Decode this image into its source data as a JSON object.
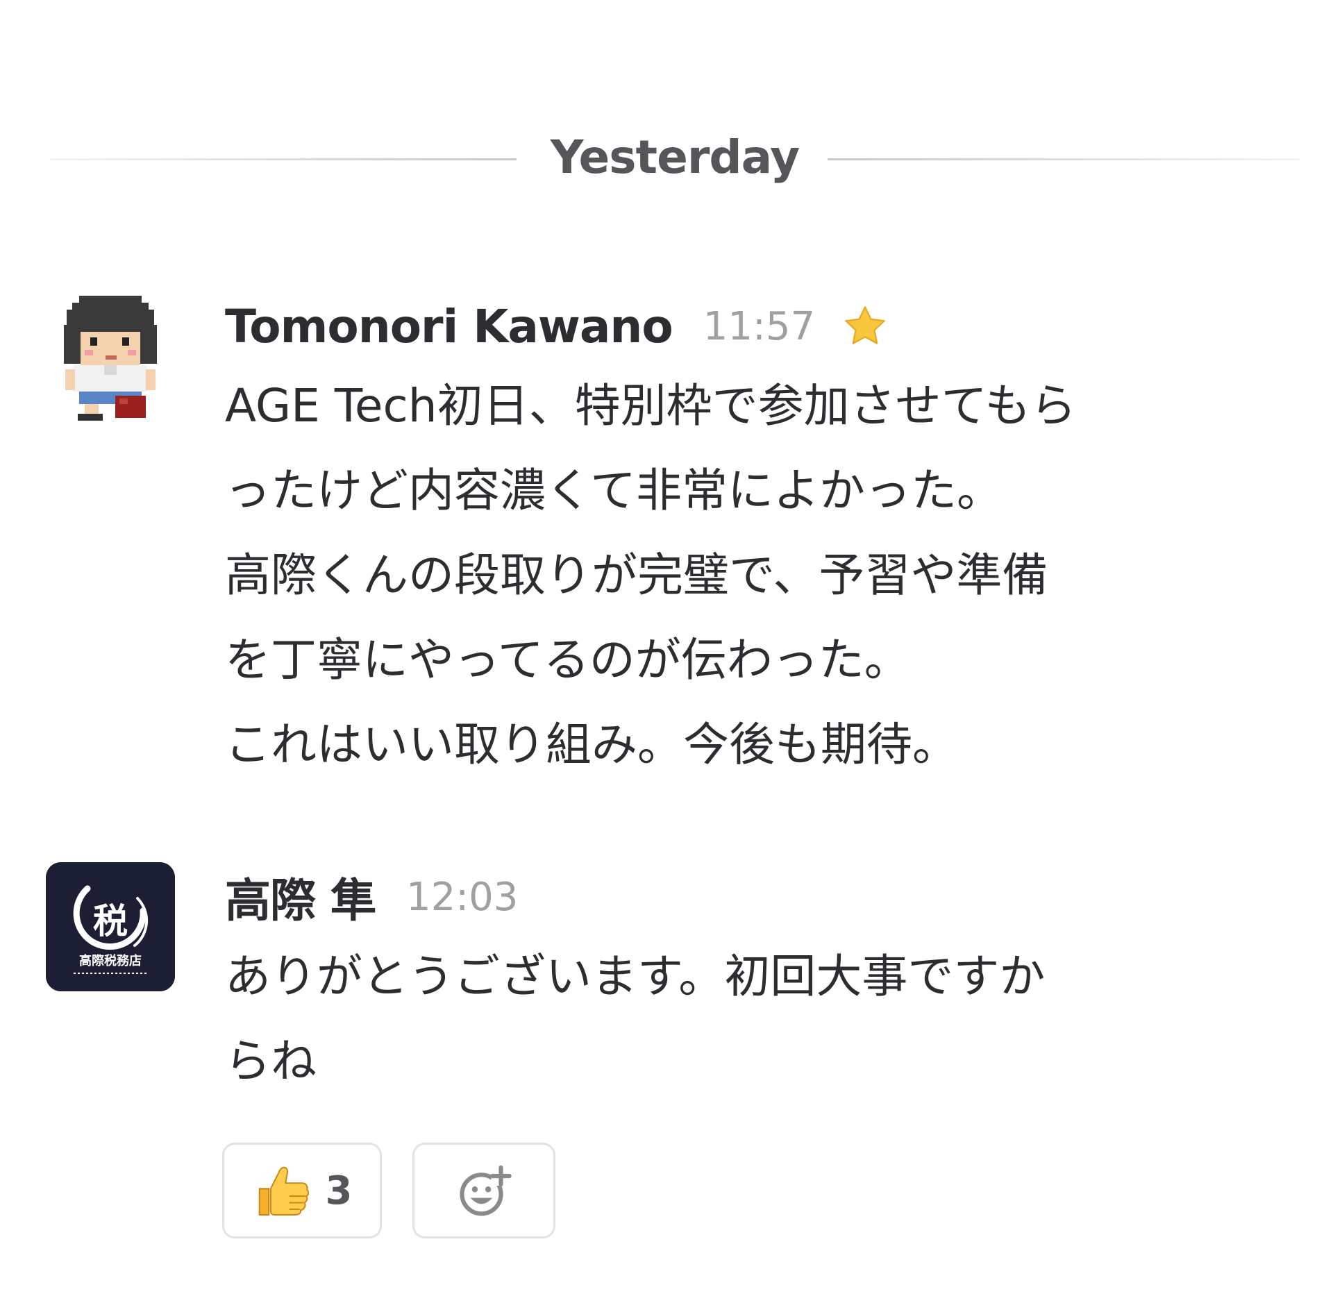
{
  "divider": {
    "label": "Yesterday"
  },
  "messages": [
    {
      "author": "Tomonori Kawano",
      "time": "11:57",
      "starred": true,
      "lines": [
        "AGE Tech初日、特別枠で参加させてもら",
        "ったけど内容濃くて非常によかった。",
        "高際くんの段取りが完璧で、予習や準備",
        "を丁寧にやってるのが伝わった。",
        "これはいい取り組み。今後も期待。"
      ],
      "avatar_icon": "pixel-art-person-avatar"
    },
    {
      "author": "高際 隼",
      "time": "12:03",
      "lines": [
        "ありがとうございます。初回大事ですか",
        "らね"
      ],
      "avatar_icon": "tax-office-logo-avatar",
      "avatar_logo_char": "税",
      "avatar_logo_caption": "高際税務店"
    }
  ],
  "reactions": [
    {
      "emoji": "thumbs-up-icon",
      "count": "3"
    },
    {
      "emoji": "add-reaction-icon"
    }
  ],
  "colors": {
    "text": "#2c2d30",
    "muted": "#a0a0a2",
    "star": "#f8c73e",
    "avatar_bg": "#1c1f33"
  }
}
